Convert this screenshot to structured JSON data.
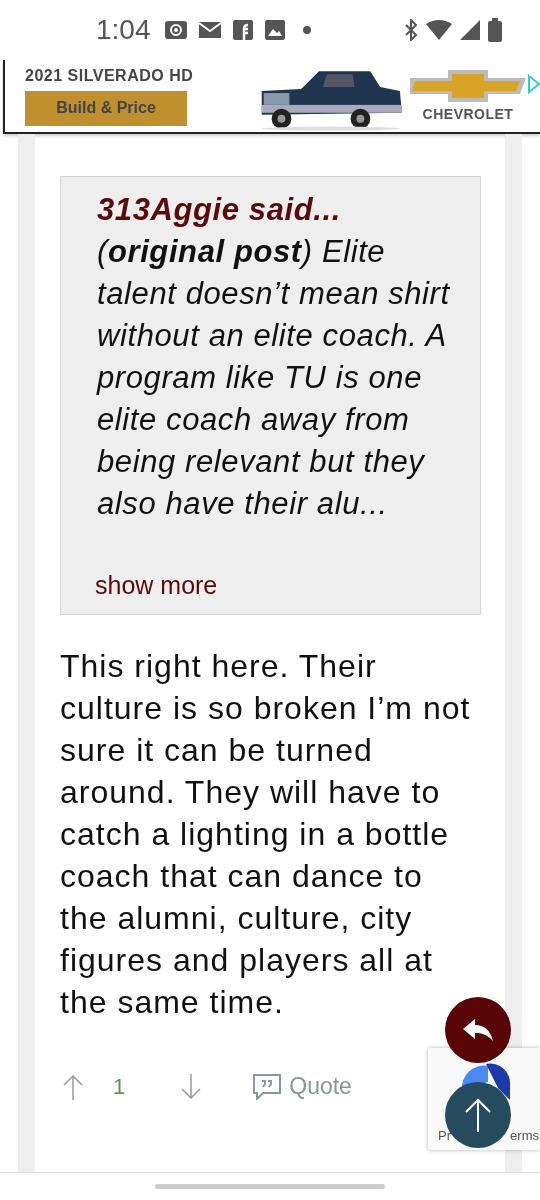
{
  "status_bar": {
    "time": "1:04"
  },
  "ad": {
    "headline": "2021 SILVERADO HD",
    "button": "Build & Price",
    "brand": "CHEVROLET"
  },
  "post": {
    "quote": {
      "author": "313Aggie said...",
      "text": "(**original post**) Elite talent doesn’t mean shirt without an elite coach. A program like TU is one elite coach away from being relevant but they also have their alu...",
      "show_more": "show more"
    },
    "body": "This right here. Their culture is so broken I’m not sure it can be turned around. They will have to catch a lighting in a bottle coach that can dance to the alumni, culture, city figures and players all at the same time.",
    "votes": "1",
    "quote_button": "Quote"
  },
  "recaptcha": {
    "left_text": "Pr",
    "right_text": "erms"
  }
}
